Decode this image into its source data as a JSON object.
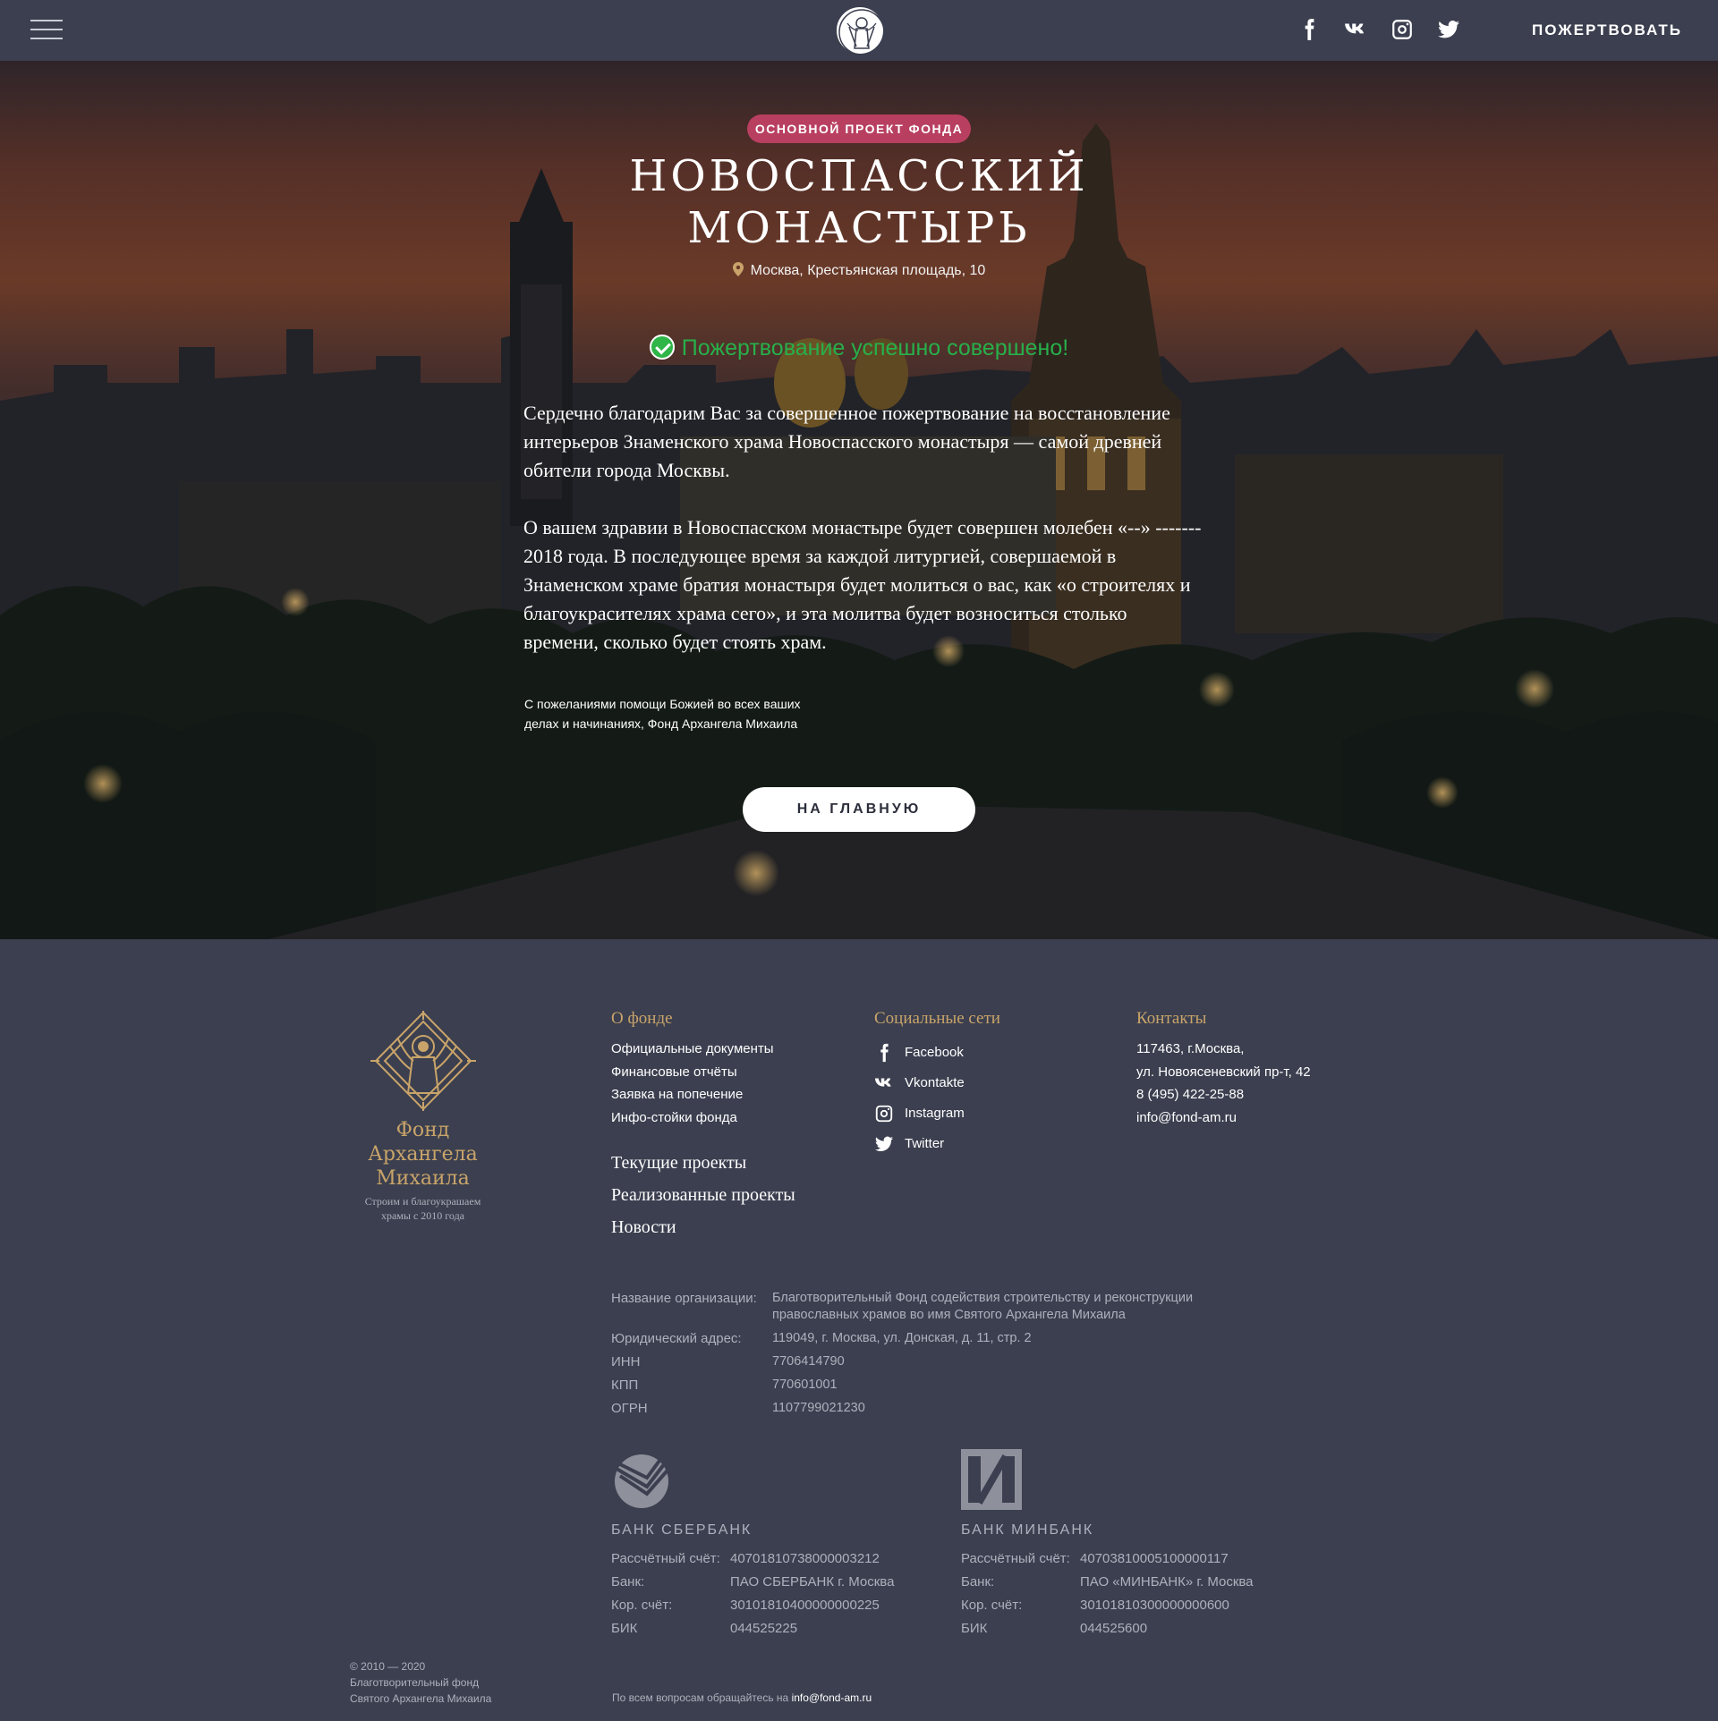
{
  "header": {
    "donate_label": "ПОЖЕРТВОВАТЬ",
    "social": [
      "facebook-icon",
      "vk-icon",
      "instagram-icon",
      "twitter-icon"
    ]
  },
  "hero": {
    "badge": "ОСНОВНОЙ ПРОЕКТ ФОНДА",
    "title_line1": "НОВОСПАССКИЙ",
    "title_line2": "МОНАСТЫРЬ",
    "address": "Москва, Крестьянская площадь, 10",
    "success": "Пожертвование успешно совершено!",
    "paragraph1": "Сердечно благодарим Вас за совершенное пожертвование на восстановление интерьеров Знаменского храма Новоспасского монастыря — самой древней обители города Москвы.",
    "paragraph2": "О вашем здравии в Новоспасском монастыре будет совершен молебен «--» ------- 2018 года. В последующее время за каждой литургией, совершаемой в Знаменском храме братия монастыря будет молиться о вас, как «о строителях и благоукрасителях храма сего», и эта молитва будет возноситься столько времени, сколько будет стоять храм.",
    "wish_line1": "С пожеланиями помощи Божией во всех ваших",
    "wish_line2": "делах и начинаниях, Фонд Архангела Михаила",
    "home_button": "НА ГЛАВНУЮ"
  },
  "footer": {
    "logo_name": [
      "Фонд",
      "Архангела",
      "Михаила"
    ],
    "logo_tagline1": "Строим и благоукрашаем",
    "logo_tagline2": "храмы с 2010 года",
    "about": {
      "title": "О фонде",
      "links": [
        "Официальные документы",
        "Финансовые отчёты",
        "Заявка на попечение",
        "Инфо-стойки фонда"
      ]
    },
    "big_links": [
      "Текущие проекты",
      "Реализованные проекты",
      "Новости"
    ],
    "social": {
      "title": "Социальные сети",
      "items": [
        "Facebook",
        "Vkontakte",
        "Instagram",
        "Twitter"
      ]
    },
    "contacts": {
      "title": "Контакты",
      "lines": [
        "117463, г.Москва,",
        "ул. Новоясеневский пр-т, 42",
        "8 (495) 422-25-88",
        "info@fond-am.ru"
      ]
    },
    "requisites": [
      {
        "k": "Название организации:",
        "v": "Благотворительный Фонд содействия строительству и реконструкции православных храмов во имя Святого Архангела Михаила"
      },
      {
        "k": "Юридический адрес:",
        "v": "119049, г. Москва, ул. Донская, д. 11, стр. 2"
      },
      {
        "k": "ИНН",
        "v": "7706414790"
      },
      {
        "k": "КПП",
        "v": "770601001"
      },
      {
        "k": "ОГРН",
        "v": "1107799021230"
      }
    ],
    "banks": [
      {
        "name": "БАНК СБЕРБАНК",
        "rows": [
          {
            "k": "Рассчётный счёт:",
            "v": "40701810738000003212"
          },
          {
            "k": "Банк:",
            "v": "ПАО СБЕРБАНК г. Москва"
          },
          {
            "k": "Кор. счёт:",
            "v": "30101810400000000225"
          },
          {
            "k": "БИК",
            "v": "044525225"
          }
        ]
      },
      {
        "name": "БАНК МИНБАНК",
        "rows": [
          {
            "k": "Рассчётный счёт:",
            "v": "40703810005100000117"
          },
          {
            "k": "Банк:",
            "v": "ПАО «МИНБАНК» г. Москва"
          },
          {
            "k": "Кор. счёт:",
            "v": "30101810300000000600"
          },
          {
            "k": "БИК",
            "v": "044525600"
          }
        ]
      }
    ],
    "copyright1": "© 2010 — 2020",
    "copyright2": "Благотворительный фонд",
    "copyright3": "Святого Архангела Михаила",
    "contact_prefix": "По всем вопросам обращайтесь на",
    "contact_email": "info@fond-am.ru"
  },
  "colors": {
    "background": "#3b3f4f",
    "gold": "#c9a46a",
    "badge": "#b83f60",
    "success": "#27b04a"
  }
}
